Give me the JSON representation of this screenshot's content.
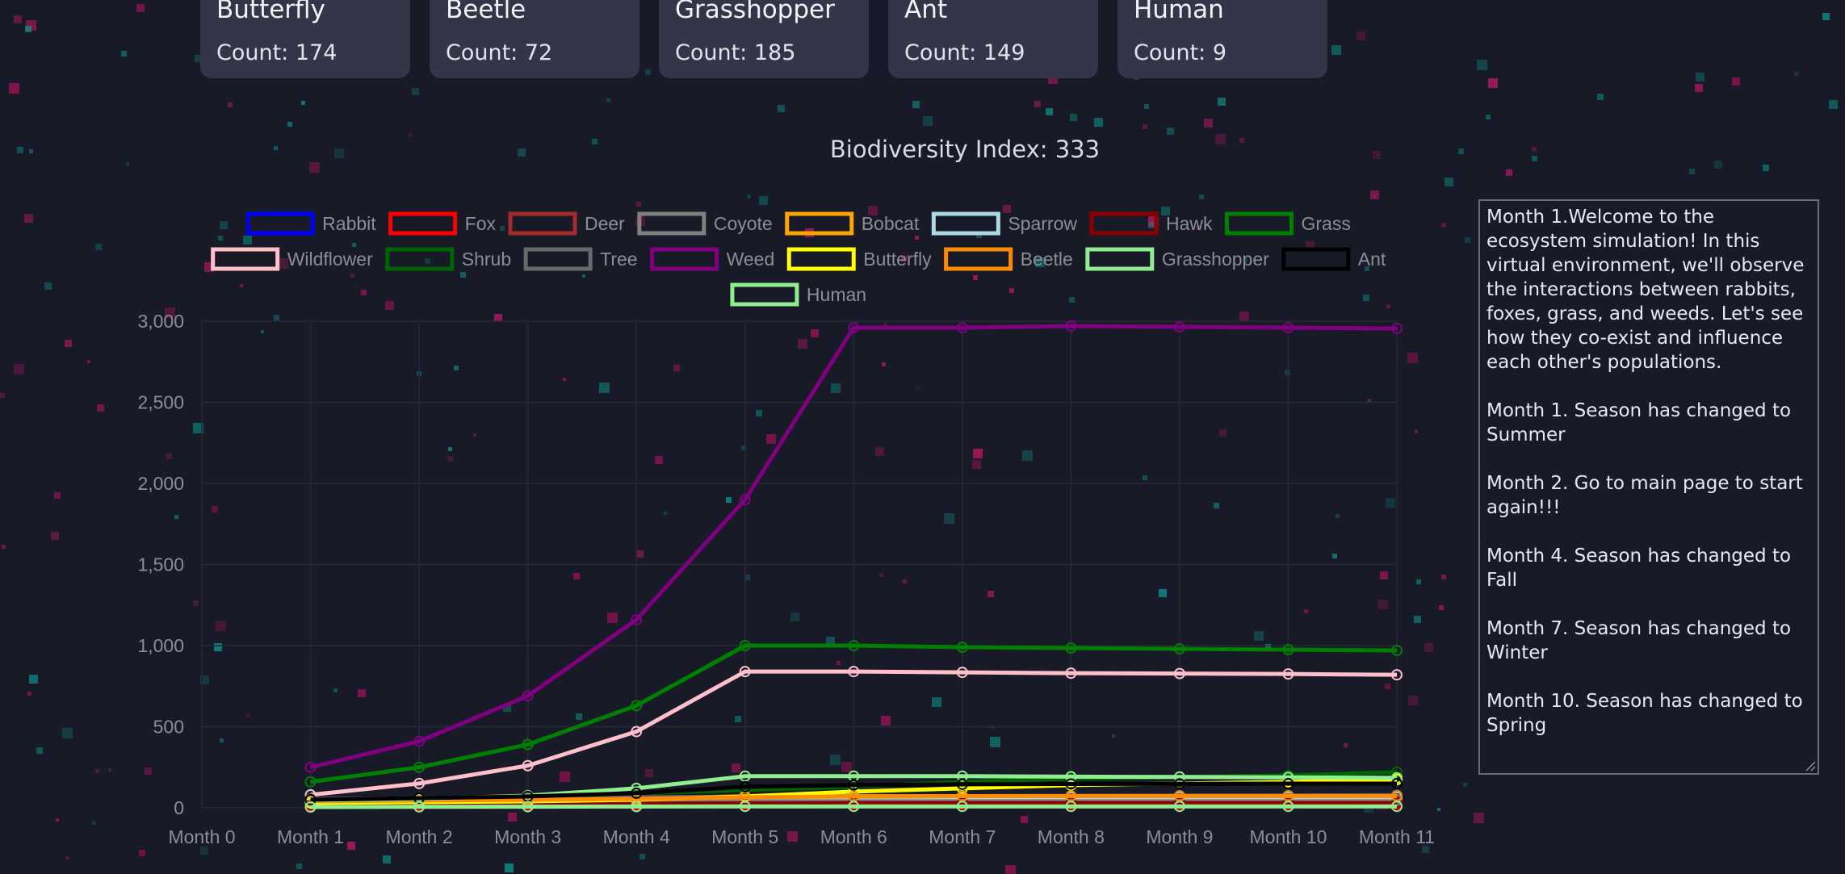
{
  "cards": [
    {
      "name": "Butterfly",
      "count": "Count: 174"
    },
    {
      "name": "Beetle",
      "count": "Count: 72"
    },
    {
      "name": "Grasshopper",
      "count": "Count: 185"
    },
    {
      "name": "Ant",
      "count": "Count: 149"
    },
    {
      "name": "Human",
      "count": "Count: 9"
    }
  ],
  "biodiversity_label": "Biodiversity Index: 333",
  "log": [
    "Month 1.Welcome to the ecosystem simulation! In this virtual environment, we'll observe the interactions between rabbits, foxes, grass, and weeds. Let's see how they co-exist and influence each other's populations.",
    "Month 1. Season has changed to Summer",
    "Month 2. Go to main page to start again!!!",
    "Month 4. Season has changed to Fall",
    "Month 7. Season has changed to Winter",
    "Month 10. Season has changed to Spring"
  ],
  "chart_data": {
    "type": "line",
    "title": "",
    "xlabel": "",
    "ylabel": "",
    "x": [
      "Month 0",
      "Month 1",
      "Month 2",
      "Month 3",
      "Month 4",
      "Month 5",
      "Month 6",
      "Month 7",
      "Month 8",
      "Month 9",
      "Month 10",
      "Month 11"
    ],
    "yticks": [
      "0",
      "500",
      "1,000",
      "1,500",
      "2,000",
      "2,500",
      "3,000"
    ],
    "ylim": [
      0,
      3000
    ],
    "grid": true,
    "legend_position": "top",
    "series": [
      {
        "name": "Rabbit",
        "color": "#0000ff",
        "values": [
          null,
          10,
          15,
          20,
          25,
          30,
          30,
          30,
          30,
          30,
          30,
          30
        ]
      },
      {
        "name": "Fox",
        "color": "#ff0000",
        "values": [
          null,
          10,
          12,
          14,
          18,
          20,
          22,
          22,
          22,
          22,
          22,
          22
        ]
      },
      {
        "name": "Deer",
        "color": "#a52a2a",
        "values": [
          null,
          20,
          22,
          25,
          30,
          35,
          38,
          40,
          40,
          40,
          40,
          40
        ]
      },
      {
        "name": "Coyote",
        "color": "#808080",
        "values": [
          null,
          30,
          32,
          35,
          40,
          45,
          48,
          50,
          50,
          50,
          50,
          50
        ]
      },
      {
        "name": "Bobcat",
        "color": "#ffa500",
        "values": [
          null,
          40,
          45,
          50,
          60,
          70,
          72,
          72,
          72,
          72,
          72,
          72
        ]
      },
      {
        "name": "Sparrow",
        "color": "#add8e6",
        "values": [
          null,
          45,
          50,
          55,
          60,
          65,
          65,
          65,
          65,
          65,
          65,
          65
        ]
      },
      {
        "name": "Hawk",
        "color": "#8b0000",
        "values": [
          null,
          20,
          22,
          24,
          26,
          28,
          30,
          30,
          30,
          30,
          30,
          30
        ]
      },
      {
        "name": "Grass",
        "color": "#008000",
        "values": [
          null,
          160,
          250,
          390,
          630,
          1000,
          1000,
          990,
          985,
          980,
          975,
          970
        ]
      },
      {
        "name": "Wildflower",
        "color": "#ffc0cb",
        "values": [
          null,
          80,
          150,
          260,
          470,
          840,
          840,
          835,
          830,
          828,
          825,
          820
        ]
      },
      {
        "name": "Shrub",
        "color": "#006400",
        "values": [
          null,
          50,
          60,
          70,
          90,
          110,
          130,
          160,
          180,
          190,
          200,
          220
        ]
      },
      {
        "name": "Tree",
        "color": "#696969",
        "values": [
          null,
          55,
          58,
          62,
          65,
          68,
          70,
          72,
          74,
          75,
          76,
          78
        ]
      },
      {
        "name": "Weed",
        "color": "#800080",
        "values": [
          null,
          250,
          410,
          690,
          1160,
          1900,
          2960,
          2960,
          2970,
          2965,
          2960,
          2955
        ]
      },
      {
        "name": "Butterfly",
        "color": "#ffff00",
        "values": [
          null,
          30,
          35,
          40,
          50,
          70,
          100,
          120,
          140,
          150,
          160,
          174
        ]
      },
      {
        "name": "Beetle",
        "color": "#ff8c00",
        "values": [
          null,
          40,
          45,
          50,
          55,
          65,
          70,
          72,
          72,
          72,
          72,
          72
        ]
      },
      {
        "name": "Grasshopper",
        "color": "#90ee90",
        "values": [
          null,
          45,
          55,
          75,
          120,
          195,
          195,
          195,
          192,
          190,
          188,
          185
        ]
      },
      {
        "name": "Ant",
        "color": "#000000",
        "values": [
          null,
          50,
          60,
          70,
          90,
          130,
          140,
          145,
          147,
          148,
          149,
          149
        ]
      },
      {
        "name": "Human",
        "color": "#90ee90",
        "values": [
          null,
          5,
          6,
          7,
          8,
          9,
          9,
          9,
          9,
          9,
          9,
          9
        ]
      }
    ]
  }
}
